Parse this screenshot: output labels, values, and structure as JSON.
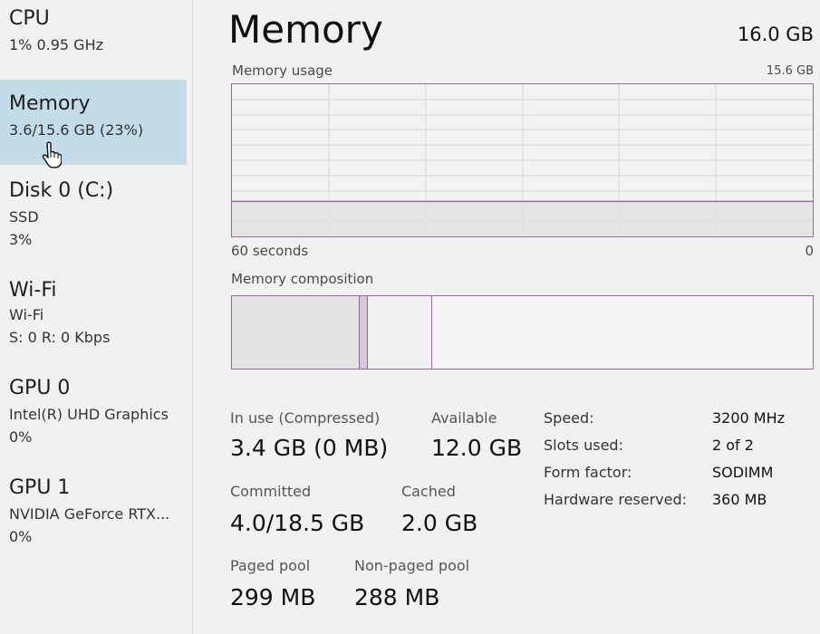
{
  "sidebar": {
    "items": [
      {
        "title": "CPU",
        "lines": [
          "1%  0.95 GHz"
        ]
      },
      {
        "title": "Memory",
        "lines": [
          "3.6/15.6 GB (23%)"
        ],
        "selected": true
      },
      {
        "title": "Disk 0 (C:)",
        "lines": [
          "SSD",
          "3%"
        ]
      },
      {
        "title": "Wi-Fi",
        "lines": [
          "Wi-Fi",
          "S: 0  R: 0 Kbps"
        ]
      },
      {
        "title": "GPU 0",
        "lines": [
          "Intel(R) UHD Graphics",
          "0%"
        ]
      },
      {
        "title": "GPU 1",
        "lines": [
          "NVIDIA GeForce RTX...",
          "0%"
        ]
      }
    ]
  },
  "header": {
    "title": "Memory",
    "total": "16.0 GB"
  },
  "usage_graph": {
    "label": "Memory usage",
    "max_label": "15.6 GB",
    "time_label": "60 seconds",
    "zero_label": "0",
    "usage_fraction": 0.23,
    "line_color": "#8a6f9b",
    "fill_color": "#e2e2e2"
  },
  "composition": {
    "label": "Memory composition",
    "segments": [
      {
        "name": "in-use",
        "fraction": 0.22,
        "color": "#e4e4e4"
      },
      {
        "name": "modified",
        "fraction": 0.014,
        "color": "#d2c8d8"
      },
      {
        "name": "standby",
        "fraction": 0.11,
        "color": "#f1f1f1"
      },
      {
        "name": "free",
        "fraction": 0.656,
        "color": "#f4f4f4"
      }
    ]
  },
  "stats": {
    "in_use_label": "In use (Compressed)",
    "in_use_value": "3.4 GB (0 MB)",
    "available_label": "Available",
    "available_value": "12.0 GB",
    "committed_label": "Committed",
    "committed_value": "4.0/18.5 GB",
    "cached_label": "Cached",
    "cached_value": "2.0 GB",
    "paged_label": "Paged pool",
    "paged_value": "299 MB",
    "nonpaged_label": "Non-paged pool",
    "nonpaged_value": "288 MB"
  },
  "specs": [
    {
      "key": "Speed:",
      "value": "3200 MHz"
    },
    {
      "key": "Slots used:",
      "value": "2 of 2"
    },
    {
      "key": "Form factor:",
      "value": "SODIMM"
    },
    {
      "key": "Hardware reserved:",
      "value": "360 MB"
    }
  ]
}
